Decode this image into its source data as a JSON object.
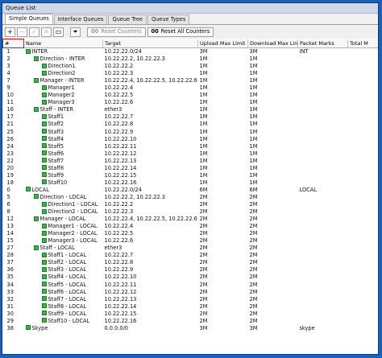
{
  "window": {
    "title": "Queue List"
  },
  "tabs": [
    "Simple Queues",
    "Interface Queues",
    "Queue Tree",
    "Queue Types"
  ],
  "toolbar": {
    "reset_counters": "Reset Counters",
    "reset_all_counters": "Reset All Counters",
    "icon_reset_counters": "00",
    "icon_reset_all_counters": "00"
  },
  "columns": [
    "#",
    "Name",
    "Target",
    "Upload Max Limit",
    "Download Max Limit",
    "Packet Marks",
    "Total M"
  ],
  "rows": [
    {
      "num": "1",
      "name": "INTER",
      "indent": 1,
      "target": "10.22.22.0/24",
      "up": "3M",
      "down": "3M",
      "marks": "INT"
    },
    {
      "num": "2",
      "name": "Direction - INTER",
      "indent": 2,
      "target": "10.22.22.2, 10.22.22.3",
      "up": "1M",
      "down": "1M",
      "marks": ""
    },
    {
      "num": "3",
      "name": "Direction1",
      "indent": 3,
      "target": "10.22.22.2",
      "up": "1M",
      "down": "1M",
      "marks": ""
    },
    {
      "num": "4",
      "name": "Direction2",
      "indent": 3,
      "target": "10.22.22.3",
      "up": "1M",
      "down": "1M",
      "marks": ""
    },
    {
      "num": "7",
      "name": "Manager - INTER",
      "indent": 2,
      "target": "10.22.22.4, 10.22.22.5, 10.22.22.6",
      "up": "1M",
      "down": "1M",
      "marks": ""
    },
    {
      "num": "9",
      "name": "Manager1",
      "indent": 3,
      "target": "10.22.22.4",
      "up": "1M",
      "down": "1M",
      "marks": ""
    },
    {
      "num": "10",
      "name": "Manager2",
      "indent": 3,
      "target": "10.22.22.5",
      "up": "1M",
      "down": "1M",
      "marks": ""
    },
    {
      "num": "11",
      "name": "Manager3",
      "indent": 3,
      "target": "10.22.22.6",
      "up": "1M",
      "down": "1M",
      "marks": ""
    },
    {
      "num": "16",
      "name": "Staff - INTER",
      "indent": 2,
      "target": "ether3",
      "up": "1M",
      "down": "1M",
      "marks": ""
    },
    {
      "num": "17",
      "name": "Staff1",
      "indent": 3,
      "target": "10.22.22.7",
      "up": "1M",
      "down": "1M",
      "marks": ""
    },
    {
      "num": "21",
      "name": "Staff2",
      "indent": 3,
      "target": "10.22.22.8",
      "up": "1M",
      "down": "1M",
      "marks": ""
    },
    {
      "num": "25",
      "name": "Staff3",
      "indent": 3,
      "target": "10.22.22.9",
      "up": "1M",
      "down": "1M",
      "marks": ""
    },
    {
      "num": "26",
      "name": "Staff4",
      "indent": 3,
      "target": "10.22.22.10",
      "up": "1M",
      "down": "1M",
      "marks": ""
    },
    {
      "num": "24",
      "name": "Staff5",
      "indent": 3,
      "target": "10.22.22.11",
      "up": "1M",
      "down": "1M",
      "marks": ""
    },
    {
      "num": "23",
      "name": "Staff6",
      "indent": 3,
      "target": "10.22.22.12",
      "up": "1M",
      "down": "1M",
      "marks": ""
    },
    {
      "num": "22",
      "name": "Staff7",
      "indent": 3,
      "target": "10.22.22.13",
      "up": "1M",
      "down": "1M",
      "marks": ""
    },
    {
      "num": "20",
      "name": "Staff8",
      "indent": 3,
      "target": "10.22.22.14",
      "up": "1M",
      "down": "1M",
      "marks": ""
    },
    {
      "num": "19",
      "name": "Staff9",
      "indent": 3,
      "target": "10.22.22.15",
      "up": "1M",
      "down": "1M",
      "marks": ""
    },
    {
      "num": "18",
      "name": "Staff10",
      "indent": 3,
      "target": "10.22.22.16",
      "up": "1M",
      "down": "1M",
      "marks": ""
    },
    {
      "num": "0",
      "name": "LOCAL",
      "indent": 1,
      "target": "10.22.22.0/24",
      "up": "6M",
      "down": "6M",
      "marks": "LOCAL"
    },
    {
      "num": "5",
      "name": "Direction - LOCAL",
      "indent": 2,
      "target": "10.22.22.2, 10.22.22.3",
      "up": "2M",
      "down": "2M",
      "marks": ""
    },
    {
      "num": "6",
      "name": "Direction1 - LOCAL",
      "indent": 3,
      "target": "10.22.22.2",
      "up": "2M",
      "down": "2M",
      "marks": ""
    },
    {
      "num": "8",
      "name": "Direction2 - LOCAL",
      "indent": 3,
      "target": "10.22.22.3",
      "up": "2M",
      "down": "2M",
      "marks": ""
    },
    {
      "num": "12",
      "name": "Manager - LOCAL",
      "indent": 2,
      "target": "10.22.22.4, 10.22.22.5, 10.22.22.6",
      "up": "2M",
      "down": "2M",
      "marks": ""
    },
    {
      "num": "13",
      "name": "Manager1 - LOCAL",
      "indent": 3,
      "target": "10.22.22.4",
      "up": "2M",
      "down": "2M",
      "marks": ""
    },
    {
      "num": "14",
      "name": "Manager2 - LOCAL",
      "indent": 3,
      "target": "10.22.22.5",
      "up": "2M",
      "down": "2M",
      "marks": ""
    },
    {
      "num": "15",
      "name": "Manager3 - LOCAL",
      "indent": 3,
      "target": "10.22.22.6",
      "up": "2M",
      "down": "2M",
      "marks": ""
    },
    {
      "num": "27",
      "name": "Staff - LOCAL",
      "indent": 2,
      "target": "ether3",
      "up": "2M",
      "down": "2M",
      "marks": ""
    },
    {
      "num": "28",
      "name": "Staff1 - LOCAL",
      "indent": 3,
      "target": "10.22.22.7",
      "up": "2M",
      "down": "2M",
      "marks": ""
    },
    {
      "num": "37",
      "name": "Staff2 - LOCAL",
      "indent": 3,
      "target": "10.22.22.8",
      "up": "2M",
      "down": "2M",
      "marks": ""
    },
    {
      "num": "36",
      "name": "Staff3 - LOCAL",
      "indent": 3,
      "target": "10.22.22.9",
      "up": "2M",
      "down": "2M",
      "marks": ""
    },
    {
      "num": "35",
      "name": "Staff4 - LOCAL",
      "indent": 3,
      "target": "10.22.22.10",
      "up": "2M",
      "down": "2M",
      "marks": ""
    },
    {
      "num": "34",
      "name": "Staff5 - LOCAL",
      "indent": 3,
      "target": "10.22.22.11",
      "up": "2M",
      "down": "2M",
      "marks": ""
    },
    {
      "num": "33",
      "name": "Staff6 - LOCAL",
      "indent": 3,
      "target": "10.22.22.12",
      "up": "2M",
      "down": "2M",
      "marks": ""
    },
    {
      "num": "32",
      "name": "Staff7 - LOCAL",
      "indent": 3,
      "target": "10.22.22.13",
      "up": "2M",
      "down": "2M",
      "marks": ""
    },
    {
      "num": "31",
      "name": "Staff8 - LOCAL",
      "indent": 3,
      "target": "10.22.22.14",
      "up": "2M",
      "down": "2M",
      "marks": ""
    },
    {
      "num": "30",
      "name": "Staff9 - LOCAL",
      "indent": 3,
      "target": "10.22.22.15",
      "up": "2M",
      "down": "2M",
      "marks": ""
    },
    {
      "num": "29",
      "name": "Staff10 - LOCAL",
      "indent": 3,
      "target": "10.22.22.16",
      "up": "2M",
      "down": "2M",
      "marks": ""
    },
    {
      "num": "38",
      "name": "Skype",
      "indent": 1,
      "target": "0.0.0.0/0",
      "up": "3M",
      "down": "3M",
      "marks": "skype"
    }
  ],
  "colors": {
    "background": "#1c5fbd",
    "queue_icon": "#39b54a",
    "header_highlight": "#e01010"
  }
}
